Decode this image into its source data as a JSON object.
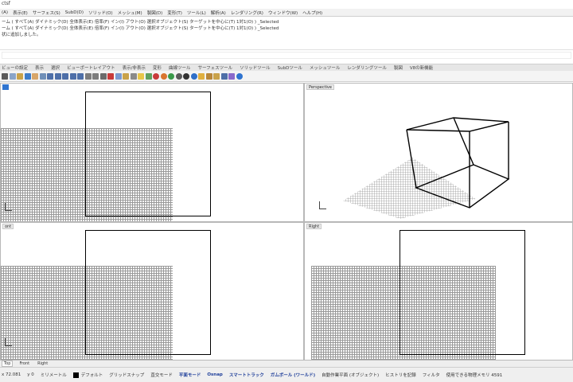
{
  "window": {
    "title": "ctsf"
  },
  "menubar": {
    "items": [
      "(A)",
      "表示(E)",
      "サーフェス(S)",
      "SubD(D)",
      "ソリッド(O)",
      "メッシュ(M)",
      "製図(D)",
      "変形(T)",
      "ツール(L)",
      "解析(A)",
      "レンダリング(R)",
      "ウィンドウ(W)",
      "ヘルプ(H)"
    ]
  },
  "command_history": {
    "lines": [
      "ーム ( すべて(A)  ダイナミック(D)  全体表示(E)  倍率(F)  イン(I)  アウト(O)  選択オブジェクト(S)  ターゲットを中心に(T)  1対1(O) ) _Selected",
      "ーム ( すべて(A)  ダイナミック(D)  全体表示(E)  倍率(F)  イン(I)  アウト(O)  選択オブジェクト(S)  ターゲットを中心に(T)  1対1(O) ) _Selected",
      "状に追加しました。"
    ]
  },
  "toolbar_tabs": [
    "ビューの設定",
    "表示",
    "選択",
    "ビューポートレイアウト",
    "表示/非表示",
    "変形",
    "曲線ツール",
    "サーフェスツール",
    "ソリッドツール",
    "SubDツール",
    "メッシュツール",
    "レンダリングツール",
    "製図",
    "V8の新機能"
  ],
  "toolbar": {
    "icons": [
      {
        "name": "x-icon",
        "color": "#5a5a5a"
      },
      {
        "name": "copy-icon",
        "color": "#8aa4c8"
      },
      {
        "name": "clipboard-icon",
        "color": "#c9a24a"
      },
      {
        "name": "undo-icon",
        "color": "#3d7cc9"
      },
      {
        "name": "pan-hand-icon",
        "color": "#d8a66a"
      },
      {
        "name": "rotate-icon",
        "color": "#6f8fb8"
      },
      {
        "name": "zoom-dynamic-icon",
        "color": "#4e6fa8"
      },
      {
        "name": "zoom-window-icon",
        "color": "#4e6fa8"
      },
      {
        "name": "zoom-extents-icon",
        "color": "#4e6fa8"
      },
      {
        "name": "zoom-selected-icon",
        "color": "#4e6fa8"
      },
      {
        "name": "magnify-icon",
        "color": "#4e6fa8"
      },
      {
        "name": "named-view-icon",
        "color": "#7c7c7c"
      },
      {
        "name": "viewport-layout-icon",
        "color": "#7c7c7c"
      },
      {
        "name": "4-view-icon",
        "color": "#6a6a6a"
      },
      {
        "name": "hide-icon",
        "color": "#c83a3a"
      },
      {
        "name": "show-icon",
        "color": "#7a9ad0"
      },
      {
        "name": "lock-icon",
        "color": "#c9a24a"
      },
      {
        "name": "grid-snap-icon",
        "color": "#8a8a8a"
      },
      {
        "name": "light-bulb-icon",
        "color": "#e8c64a"
      },
      {
        "name": "layer-icon",
        "color": "#5fa05f"
      },
      {
        "name": "color-sphere-icon",
        "color": "#c83a3a"
      },
      {
        "name": "material-sphere-icon",
        "color": "#d9742f"
      },
      {
        "name": "render-sphere-icon",
        "color": "#3a9a4a"
      },
      {
        "name": "gray-sphere-icon",
        "color": "#5a5a5a"
      },
      {
        "name": "shaded-sphere-icon",
        "color": "#333333"
      },
      {
        "name": "globe-icon",
        "color": "#2f6fc8"
      },
      {
        "name": "pen-icon",
        "color": "#e0b040"
      },
      {
        "name": "camera-icon",
        "color": "#b8873a"
      },
      {
        "name": "target-icon",
        "color": "#c9a24a"
      },
      {
        "name": "properties-icon",
        "color": "#4e6fa8"
      },
      {
        "name": "block-icon",
        "color": "#8a6acb"
      },
      {
        "name": "help-icon",
        "color": "#2f74d0"
      }
    ]
  },
  "viewports": {
    "top": {
      "label": ""
    },
    "perspective": {
      "label": "Perspective"
    },
    "front": {
      "label": "ont"
    },
    "right": {
      "label": "Right"
    }
  },
  "viewport_tabs": [
    "Top",
    "Front",
    "Right"
  ],
  "statusbar": {
    "coords": "x 72.081",
    "y": "y 0",
    "units": "ミリメートル",
    "layer": "デフォルト",
    "items": [
      "グリッドスナップ",
      "直交モード",
      "平面モード",
      "Osnap",
      "スマートトラック",
      "ガムボール (ワールド)",
      "自動作業平面 (オブジェクト)",
      "ヒストリを記録",
      "フィルタ",
      "使用できる物理メモリ 4591"
    ]
  },
  "colors": {
    "active_label": "#2f74d0",
    "status_accent": "#1f3f9a",
    "grid": "#8e8e8e"
  }
}
